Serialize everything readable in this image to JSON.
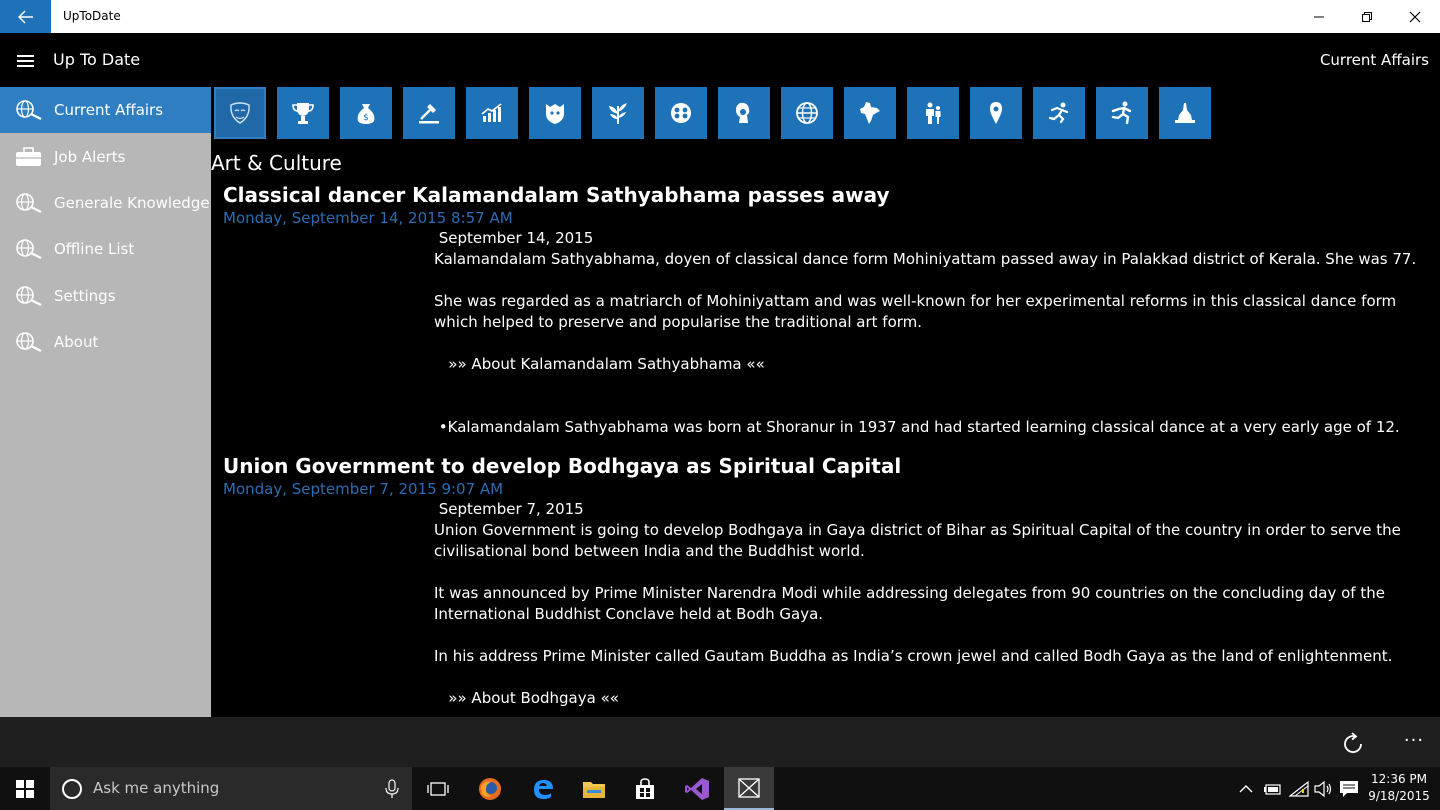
{
  "window": {
    "title": "UpToDate"
  },
  "header": {
    "app_name": "Up To Date",
    "current_section": "Current Affairs"
  },
  "sidebar": {
    "items": [
      {
        "label": "Current Affairs",
        "icon": "globe-search-icon",
        "active": true
      },
      {
        "label": "Job Alerts",
        "icon": "briefcase-icon",
        "active": false
      },
      {
        "label": "Generale Knowledge",
        "icon": "globe-search-icon",
        "active": false
      },
      {
        "label": "Offline List",
        "icon": "globe-search-icon",
        "active": false
      },
      {
        "label": "Settings",
        "icon": "globe-search-icon",
        "active": false
      },
      {
        "label": "About",
        "icon": "globe-search-icon",
        "active": false
      }
    ]
  },
  "categories": [
    {
      "icon": "art-culture-mask-icon",
      "selected": true
    },
    {
      "icon": "trophy-icon",
      "selected": false
    },
    {
      "icon": "money-bag-icon",
      "selected": false
    },
    {
      "icon": "gavel-icon",
      "selected": false
    },
    {
      "icon": "economy-chart-icon",
      "selected": false
    },
    {
      "icon": "defence-emblem-icon",
      "selected": false
    },
    {
      "icon": "agriculture-plant-icon",
      "selected": false
    },
    {
      "icon": "science-atom-icon",
      "selected": false
    },
    {
      "icon": "person-profile-icon",
      "selected": false
    },
    {
      "icon": "world-globe-icon",
      "selected": false
    },
    {
      "icon": "india-map-icon",
      "selected": false
    },
    {
      "icon": "people-icon",
      "selected": false
    },
    {
      "icon": "location-pin-icon",
      "selected": false
    },
    {
      "icon": "sports-runner-icon",
      "selected": false
    },
    {
      "icon": "sports-athlete-icon",
      "selected": false
    },
    {
      "icon": "landmark-icon",
      "selected": false
    }
  ],
  "section_title": "Art & Culture",
  "articles": [
    {
      "title": "Classical dancer Kalamandalam Sathyabhama passes away",
      "timestamp": "Monday, September 14, 2015 8:57 AM",
      "date_line": " September 14, 2015",
      "paragraphs": [
        "Kalamandalam Sathyabhama, doyen of classical dance form Mohiniyattam passed away in Palakkad district of Kerala. She was 77.",
        "She was regarded as a matriarch of Mohiniyattam and was well-known for her experimental reforms in this classical dance form which helped to preserve and popularise the traditional art form.",
        "   »» About Kalamandalam Sathyabhama ««",
        "",
        " •Kalamandalam Sathyabhama was born at Shoranur in 1937 and had started learning classical dance at a very early age of 12."
      ]
    },
    {
      "title": "Union Government to develop Bodhgaya as Spiritual Capital",
      "timestamp": "Monday, September 7, 2015 9:07 AM",
      "date_line": " September 7, 2015",
      "paragraphs": [
        "Union Government is going to develop Bodhgaya in Gaya district of Bihar as Spiritual Capital of the country in order to serve the civilisational bond between India and the Buddhist world.",
        "It was announced by Prime Minister Narendra Modi while addressing delegates from 90 countries on the concluding day of the International Buddhist Conclave held at Bodh Gaya.",
        "In his address Prime Minister called Gautam Buddha as India’s crown jewel and called Bodh Gaya as the land of enlightenment.",
        "   »» About Bodhgaya ««"
      ]
    }
  ],
  "command_bar": {
    "more": "···"
  },
  "taskbar": {
    "search_placeholder": "Ask me anything",
    "clock_time": "12:36 PM",
    "clock_date": "9/18/2015"
  },
  "colors": {
    "accent": "#1e73b8",
    "sidebar_bg": "#b7b7b7",
    "date_text": "#2b6db3"
  }
}
